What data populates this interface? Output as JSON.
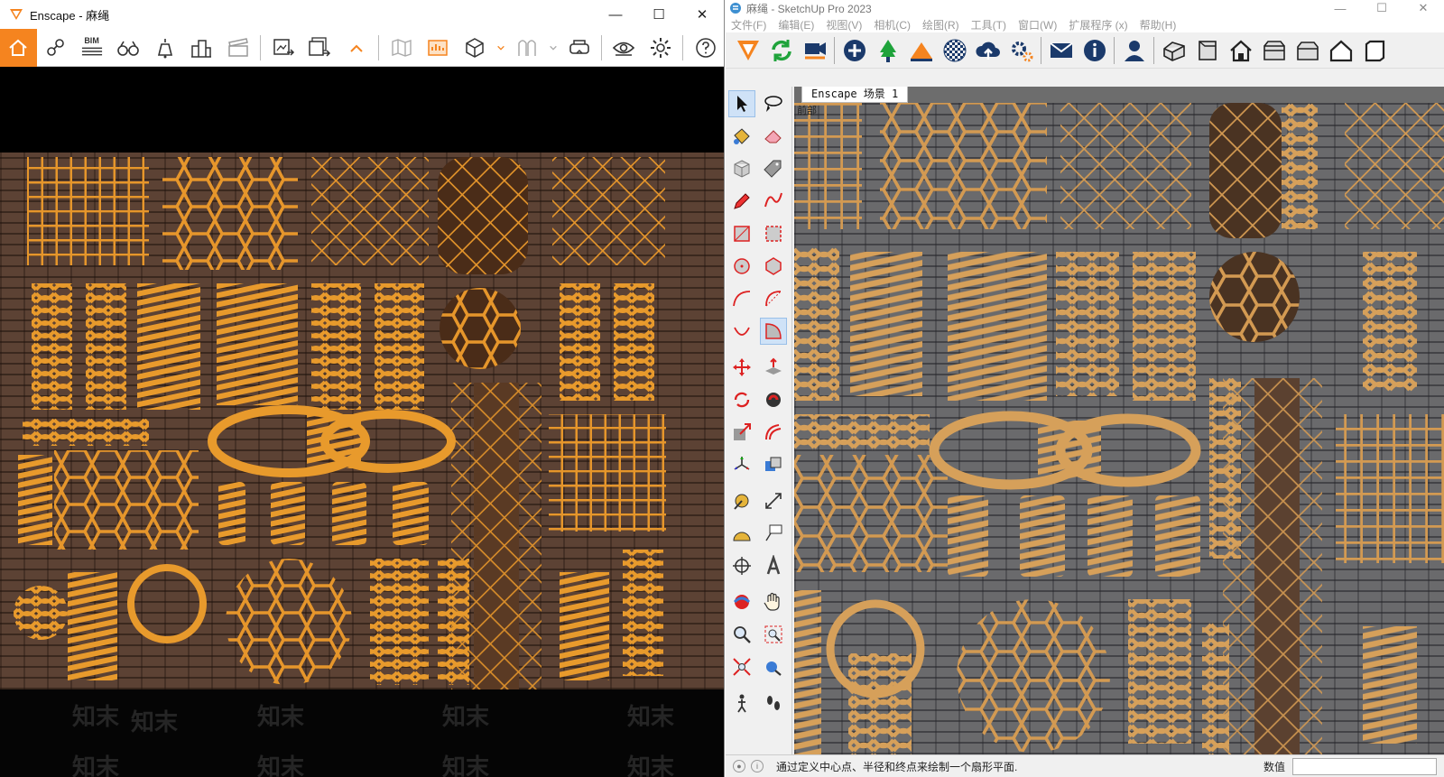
{
  "enscape": {
    "title": "Enscape - 麻绳",
    "toolbar": {
      "bim_label": "BIM",
      "tools": [
        "home-icon",
        "viewpoint-icon",
        "bim-icon",
        "binoculars-icon",
        "light-icon",
        "buildings-icon",
        "clapper-icon",
        "export-image-icon",
        "batch-export-icon",
        "collapse-icon",
        "map-icon",
        "panel-icon",
        "cube-icon",
        "asset-icon",
        "vr-headset-icon",
        "eye-icon",
        "settings-icon",
        "help-icon"
      ]
    },
    "watermark": "知末",
    "accent": "#f5841f"
  },
  "sketchup": {
    "title": "麻绳 - SketchUp Pro 2023",
    "menu": [
      "文件(F)",
      "编辑(E)",
      "视图(V)",
      "相机(C)",
      "绘图(R)",
      "工具(T)",
      "窗口(W)",
      "扩展程序 (x)",
      "帮助(H)"
    ],
    "scene_tab": "Enscape 场景 1",
    "view_label": "前部",
    "status_hint": "通过定义中心点、半径和终点来绘制一个扇形平面.",
    "value_label": "数值",
    "value": ""
  }
}
